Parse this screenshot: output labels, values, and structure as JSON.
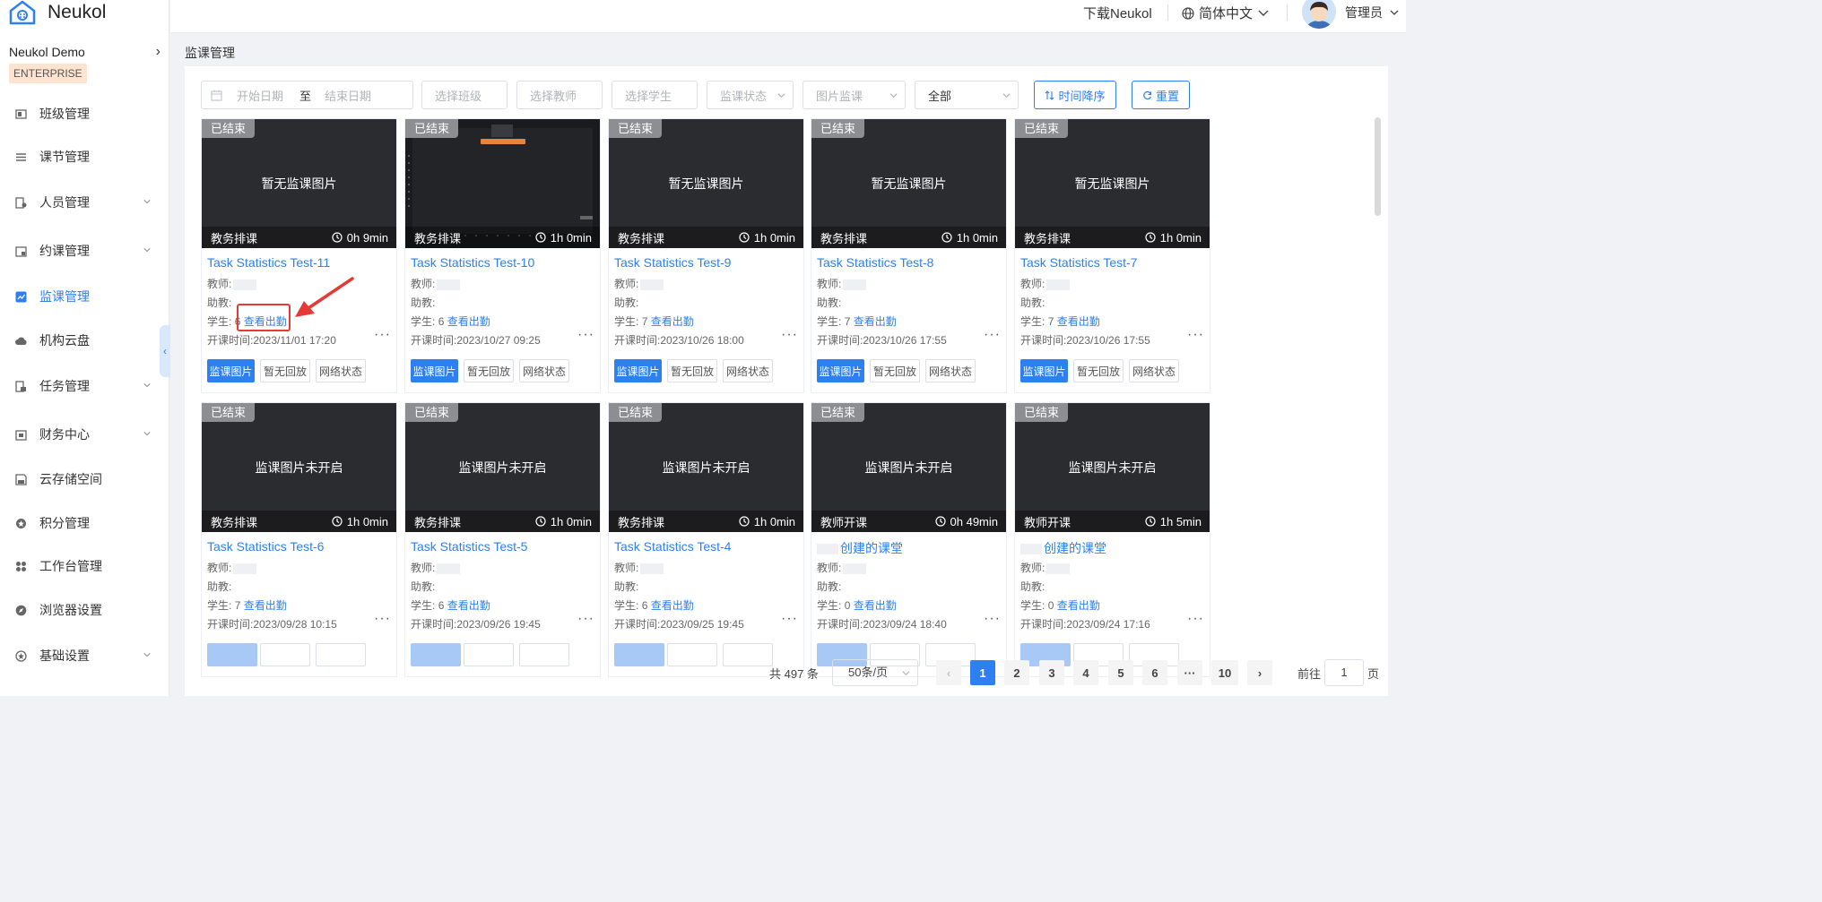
{
  "app": {
    "name": "Neukol",
    "org": "Neukol Demo",
    "edition": "ENTERPRISE"
  },
  "header": {
    "download": "下载Neukol",
    "language": "简体中文",
    "user": "管理员"
  },
  "breadcrumb": "监课管理",
  "sidebar": {
    "items": [
      {
        "label": "班级管理",
        "icon": "class-icon",
        "expandable": false,
        "active": false
      },
      {
        "label": "课节管理",
        "icon": "list-icon",
        "expandable": false,
        "active": false
      },
      {
        "label": "人员管理",
        "icon": "people-icon",
        "expandable": true,
        "active": false
      },
      {
        "label": "约课管理",
        "icon": "booking-icon",
        "expandable": true,
        "active": false
      },
      {
        "label": "监课管理",
        "icon": "chart-icon",
        "expandable": false,
        "active": true
      },
      {
        "label": "机构云盘",
        "icon": "cloud-icon",
        "expandable": false,
        "active": false
      },
      {
        "label": "任务管理",
        "icon": "task-icon",
        "expandable": true,
        "active": false
      },
      {
        "label": "财务中心",
        "icon": "finance-icon",
        "expandable": true,
        "active": false
      },
      {
        "label": "云存储空间",
        "icon": "storage-icon",
        "expandable": false,
        "active": false
      },
      {
        "label": "积分管理",
        "icon": "points-icon",
        "expandable": false,
        "active": false
      },
      {
        "label": "工作台管理",
        "icon": "grid-icon",
        "expandable": false,
        "active": false
      },
      {
        "label": "浏览器设置",
        "icon": "compass-icon",
        "expandable": false,
        "active": false
      },
      {
        "label": "基础设置",
        "icon": "settings-icon",
        "expandable": true,
        "active": false
      }
    ]
  },
  "filters": {
    "start_date": "开始日期",
    "to": "至",
    "end_date": "结束日期",
    "class": "选择班级",
    "teacher": "选择教师",
    "student": "选择学生",
    "monitor_status": "监课状态",
    "image_monitor": "图片监课",
    "scope": "全部",
    "sort_button": "时间降序",
    "reset_button": "重置"
  },
  "cards": [
    {
      "status": "已结束",
      "thumb_text": "暂无监课图片",
      "has_screenshot": false,
      "source": "教务排课",
      "duration": "0h 9min",
      "title": "Task Statistics Test-11",
      "teacher_label": "教师:",
      "assistant_label": "助教:",
      "students_label": "学生:",
      "students": "6",
      "attendance_link": "查看出勤",
      "start_time": "开课时间:2023/11/01 17:20",
      "btn_images": "监课图片",
      "btn_playback": "暂无回放",
      "btn_network": "网络状态"
    },
    {
      "status": "已结束",
      "thumb_text": "",
      "has_screenshot": true,
      "source": "教务排课",
      "duration": "1h 0min",
      "title": "Task Statistics Test-10",
      "teacher_label": "教师:",
      "assistant_label": "助教:",
      "students_label": "学生:",
      "students": "6",
      "attendance_link": "查看出勤",
      "start_time": "开课时间:2023/10/27 09:25",
      "btn_images": "监课图片",
      "btn_playback": "暂无回放",
      "btn_network": "网络状态"
    },
    {
      "status": "已结束",
      "thumb_text": "暂无监课图片",
      "has_screenshot": false,
      "source": "教务排课",
      "duration": "1h 0min",
      "title": "Task Statistics Test-9",
      "teacher_label": "教师:",
      "assistant_label": "助教:",
      "students_label": "学生:",
      "students": "7",
      "attendance_link": "查看出勤",
      "start_time": "开课时间:2023/10/26 18:00",
      "btn_images": "监课图片",
      "btn_playback": "暂无回放",
      "btn_network": "网络状态"
    },
    {
      "status": "已结束",
      "thumb_text": "暂无监课图片",
      "has_screenshot": false,
      "source": "教务排课",
      "duration": "1h 0min",
      "title": "Task Statistics Test-8",
      "teacher_label": "教师:",
      "assistant_label": "助教:",
      "students_label": "学生:",
      "students": "7",
      "attendance_link": "查看出勤",
      "start_time": "开课时间:2023/10/26 17:55",
      "btn_images": "监课图片",
      "btn_playback": "暂无回放",
      "btn_network": "网络状态"
    },
    {
      "status": "已结束",
      "thumb_text": "暂无监课图片",
      "has_screenshot": false,
      "source": "教务排课",
      "duration": "1h 0min",
      "title": "Task Statistics Test-7",
      "teacher_label": "教师:",
      "assistant_label": "助教:",
      "students_label": "学生:",
      "students": "7",
      "attendance_link": "查看出勤",
      "start_time": "开课时间:2023/10/26 17:55",
      "btn_images": "监课图片",
      "btn_playback": "暂无回放",
      "btn_network": "网络状态"
    },
    {
      "status": "已结束",
      "thumb_text": "监课图片未开启",
      "has_screenshot": false,
      "source": "教务排课",
      "duration": "1h 0min",
      "title": "Task Statistics Test-6",
      "teacher_label": "教师:",
      "assistant_label": "助教:",
      "students_label": "学生:",
      "students": "7",
      "attendance_link": "查看出勤",
      "start_time": "开课时间:2023/09/28 10:15",
      "btn_images": "",
      "btn_playback": "",
      "btn_network": ""
    },
    {
      "status": "已结束",
      "thumb_text": "监课图片未开启",
      "has_screenshot": false,
      "source": "教务排课",
      "duration": "1h 0min",
      "title": "Task Statistics Test-5",
      "teacher_label": "教师:",
      "assistant_label": "助教:",
      "students_label": "学生:",
      "students": "6",
      "attendance_link": "查看出勤",
      "start_time": "开课时间:2023/09/26 19:45",
      "btn_images": "",
      "btn_playback": "",
      "btn_network": ""
    },
    {
      "status": "已结束",
      "thumb_text": "监课图片未开启",
      "has_screenshot": false,
      "source": "教务排课",
      "duration": "1h 0min",
      "title": "Task Statistics Test-4",
      "teacher_label": "教师:",
      "assistant_label": "助教:",
      "students_label": "学生:",
      "students": "6",
      "attendance_link": "查看出勤",
      "start_time": "开课时间:2023/09/25 19:45",
      "btn_images": "",
      "btn_playback": "",
      "btn_network": ""
    },
    {
      "status": "已结束",
      "thumb_text": "监课图片未开启",
      "has_screenshot": false,
      "source": "教师开课",
      "duration": "0h 49min",
      "title": "创建的课堂",
      "teacher_label": "教师:",
      "assistant_label": "助教:",
      "students_label": "学生:",
      "students": "0",
      "attendance_link": "查看出勤",
      "start_time": "开课时间:2023/09/24 18:40",
      "btn_images": "",
      "btn_playback": "",
      "btn_network": ""
    },
    {
      "status": "已结束",
      "thumb_text": "监课图片未开启",
      "has_screenshot": false,
      "source": "教师开课",
      "duration": "1h 5min",
      "title": "创建的课堂",
      "teacher_label": "教师:",
      "assistant_label": "助教:",
      "students_label": "学生:",
      "students": "0",
      "attendance_link": "查看出勤",
      "start_time": "开课时间:2023/09/24 17:16",
      "btn_images": "",
      "btn_playback": "",
      "btn_network": ""
    }
  ],
  "pagination": {
    "total": "共 497 条",
    "page_size": "50条/页",
    "pages": [
      "1",
      "2",
      "3",
      "4",
      "5",
      "6",
      "···",
      "10"
    ],
    "current": "1",
    "goto_label": "前往",
    "goto_value": "1",
    "goto_suffix": "页"
  },
  "colors": {
    "accent": "#2e7ff0",
    "thumb_bg": "#2b2c30",
    "annotation": "#e53935"
  }
}
